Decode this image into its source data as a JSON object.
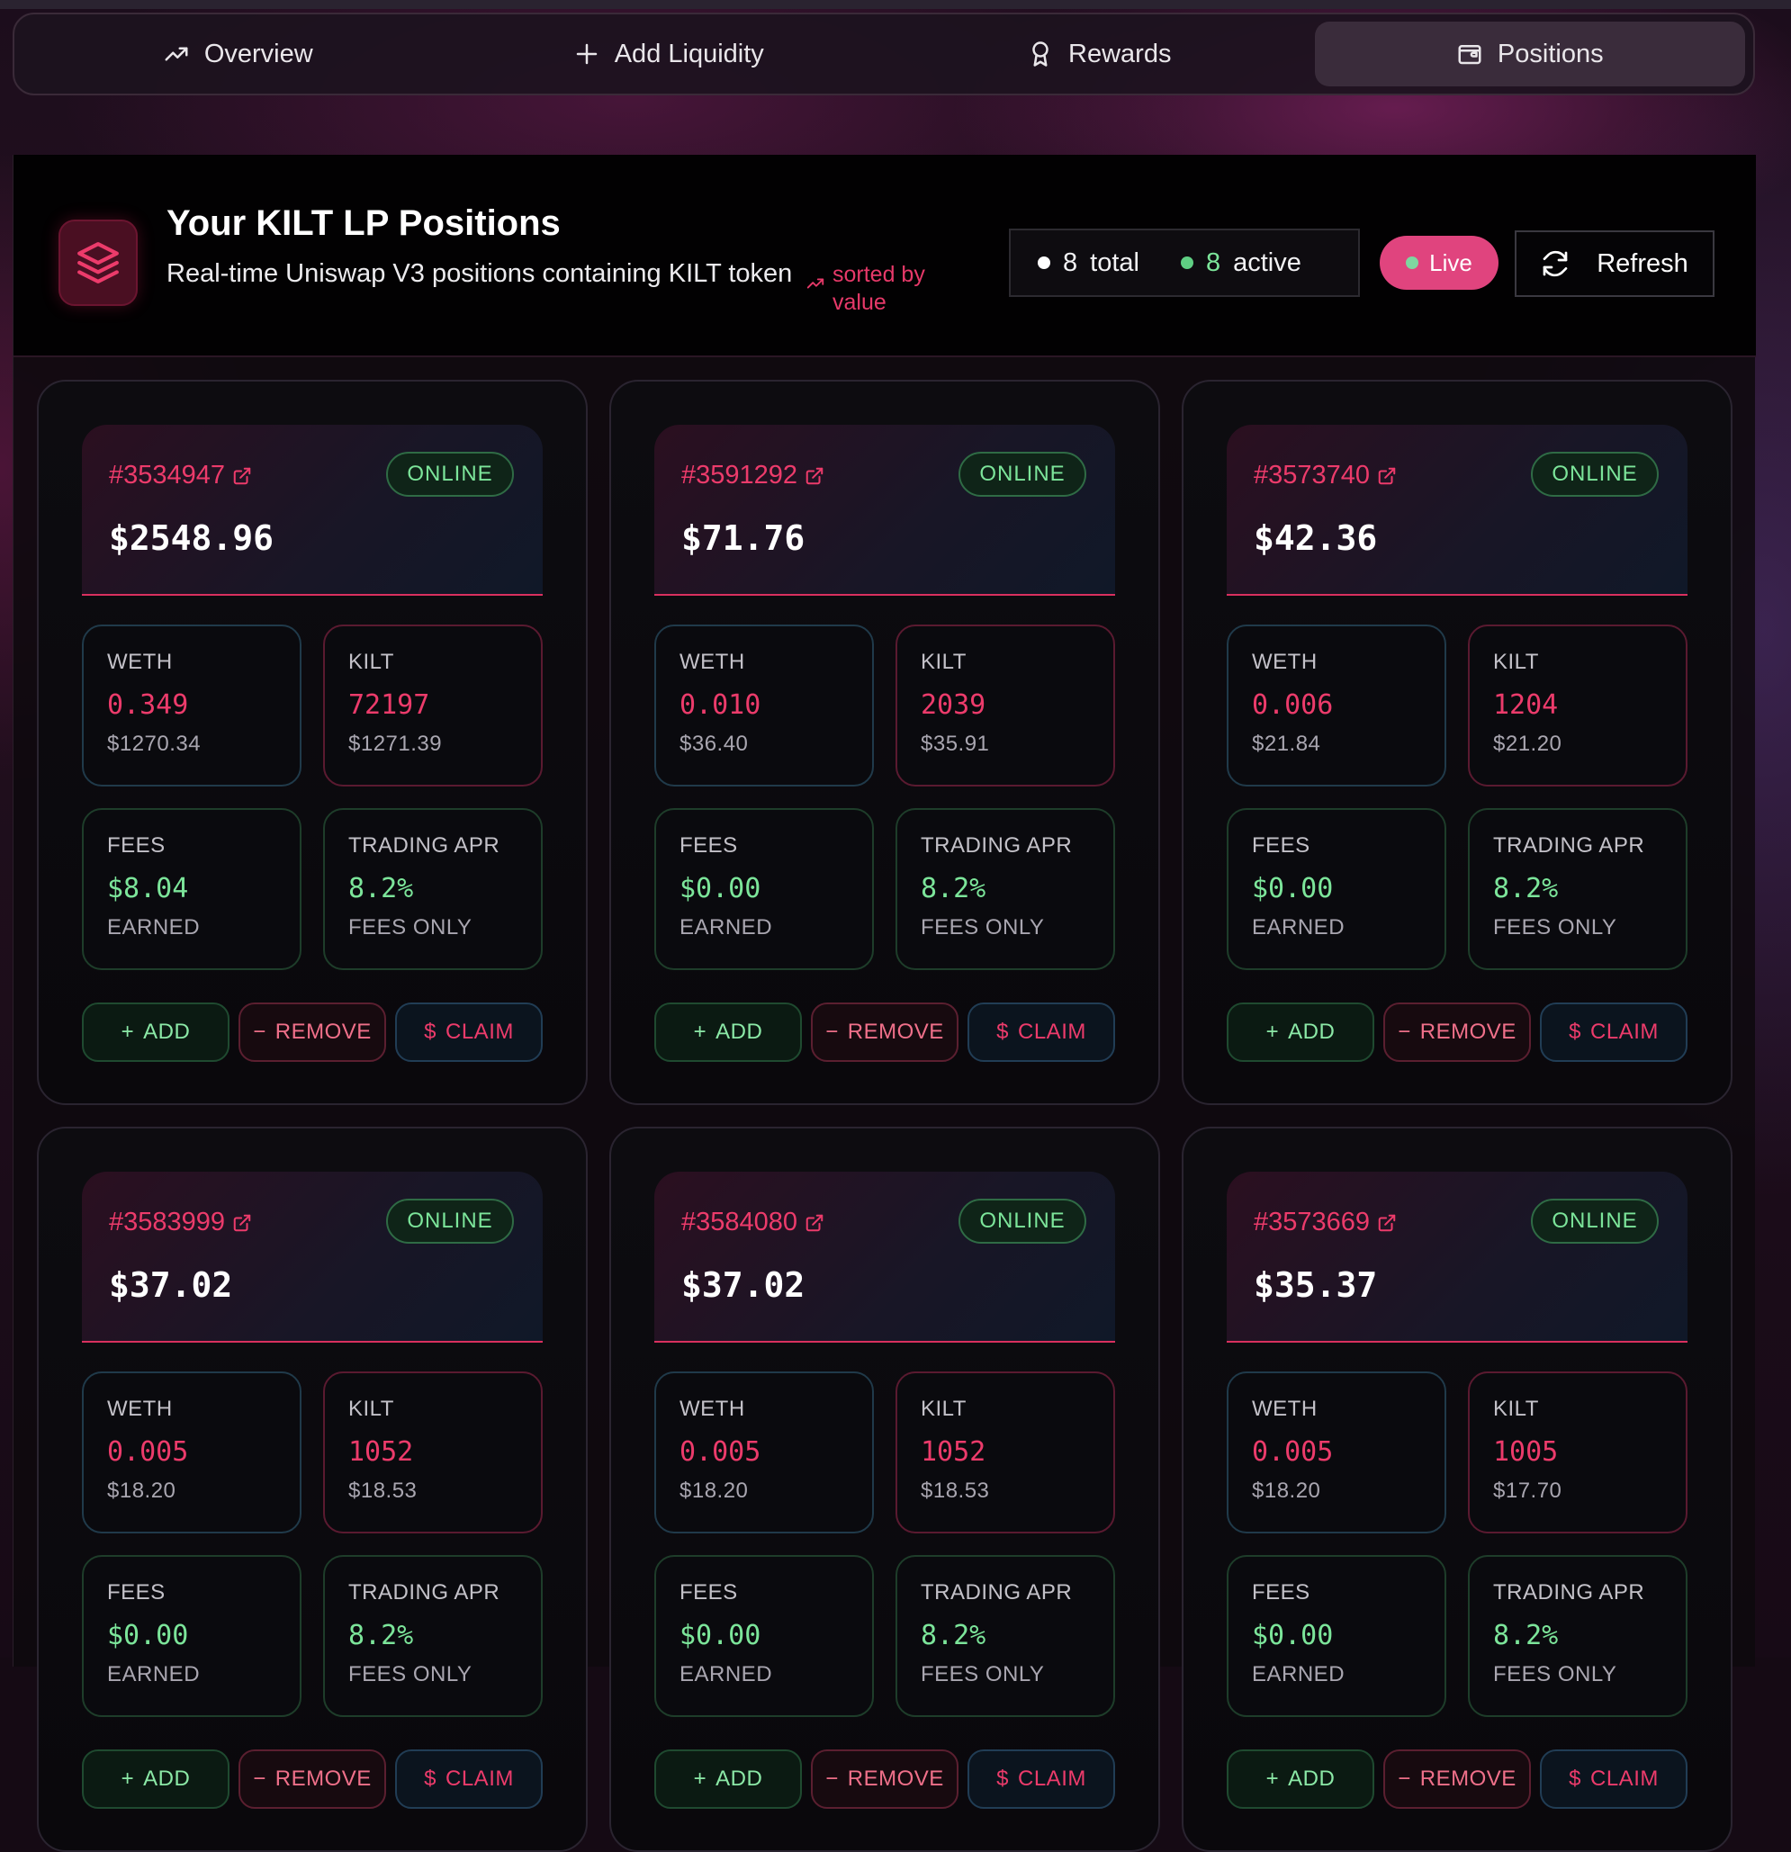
{
  "nav": {
    "tabs": [
      {
        "label": "Overview",
        "icon": "trend-icon",
        "active": false
      },
      {
        "label": "Add Liquidity",
        "icon": "plus-icon",
        "active": false
      },
      {
        "label": "Rewards",
        "icon": "award-icon",
        "active": false
      },
      {
        "label": "Positions",
        "icon": "wallet-icon",
        "active": true
      }
    ]
  },
  "header": {
    "title": "Your KILT LP Positions",
    "subtitle": "Real-time Uniswap V3 positions containing KILT token",
    "sorted_label": "sorted by value",
    "total_count": "8",
    "total_label": "total",
    "active_count": "8",
    "active_label": "active",
    "live_label": "Live",
    "refresh_label": "Refresh"
  },
  "colors": {
    "accent": "#ec3b6b",
    "positive": "#7ce59a",
    "live": "#e0447e"
  },
  "labels": {
    "weth": "WETH",
    "kilt": "KILT",
    "fees": "FEES",
    "trading_apr": "TRADING APR",
    "earned": "EARNED",
    "fees_only": "FEES ONLY",
    "add": "ADD",
    "remove": "REMOVE",
    "claim": "CLAIM"
  },
  "positions": [
    {
      "id": "#3534947",
      "status": "ONLINE",
      "value": "$2548.96",
      "weth_amount": "0.349",
      "weth_usd": "$1270.34",
      "kilt_amount": "72197",
      "kilt_usd": "$1271.39",
      "fees": "$8.04",
      "apr": "8.2%"
    },
    {
      "id": "#3591292",
      "status": "ONLINE",
      "value": "$71.76",
      "weth_amount": "0.010",
      "weth_usd": "$36.40",
      "kilt_amount": "2039",
      "kilt_usd": "$35.91",
      "fees": "$0.00",
      "apr": "8.2%"
    },
    {
      "id": "#3573740",
      "status": "ONLINE",
      "value": "$42.36",
      "weth_amount": "0.006",
      "weth_usd": "$21.84",
      "kilt_amount": "1204",
      "kilt_usd": "$21.20",
      "fees": "$0.00",
      "apr": "8.2%"
    },
    {
      "id": "#3583999",
      "status": "ONLINE",
      "value": "$37.02",
      "weth_amount": "0.005",
      "weth_usd": "$18.20",
      "kilt_amount": "1052",
      "kilt_usd": "$18.53",
      "fees": "$0.00",
      "apr": "8.2%"
    },
    {
      "id": "#3584080",
      "status": "ONLINE",
      "value": "$37.02",
      "weth_amount": "0.005",
      "weth_usd": "$18.20",
      "kilt_amount": "1052",
      "kilt_usd": "$18.53",
      "fees": "$0.00",
      "apr": "8.2%"
    },
    {
      "id": "#3573669",
      "status": "ONLINE",
      "value": "$35.37",
      "weth_amount": "0.005",
      "weth_usd": "$18.20",
      "kilt_amount": "1005",
      "kilt_usd": "$17.70",
      "fees": "$0.00",
      "apr": "8.2%"
    }
  ]
}
